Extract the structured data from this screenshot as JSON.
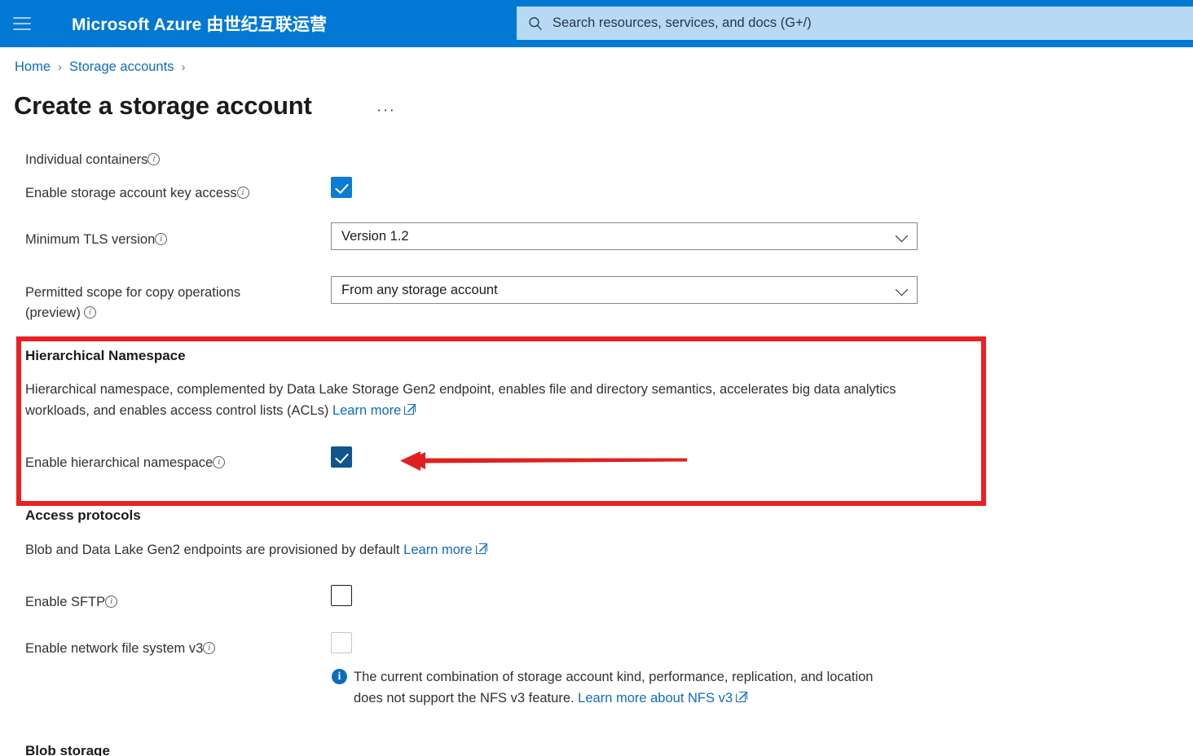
{
  "topbar": {
    "menu_icon": "hamburger-icon",
    "brand_prefix": "Microsoft Azure ",
    "brand_cn": "由世纪互联运营",
    "search": {
      "icon": "search-icon",
      "placeholder": "Search resources, services, and docs (G+/)",
      "value": ""
    }
  },
  "breadcrumb": {
    "items": [
      {
        "label": "Home"
      },
      {
        "label": "Storage accounts"
      }
    ],
    "separator": "›"
  },
  "page": {
    "title": "Create a storage account",
    "more_label": "···"
  },
  "form": {
    "truncated_top_label": "Individual containers",
    "key_access": {
      "label": "Enable storage account key access",
      "checked": true
    },
    "tls": {
      "label": "Minimum TLS version",
      "value": "Version 1.2"
    },
    "copy_scope": {
      "label_line1": "Permitted scope for copy operations",
      "label_line2": "(preview)",
      "value": "From any storage account"
    },
    "hierarchical_namespace": {
      "heading": "Hierarchical Namespace",
      "description_line1": "Hierarchical namespace, complemented by Data Lake Storage Gen2 endpoint, enables file and directory semantics, accelerates",
      "description_line2": "big data analytics workloads, and enables access control lists (ACLs)",
      "learn_more": "Learn more",
      "checkbox_label": "Enable hierarchical namespace",
      "checked": true,
      "highlight_color": "#ec2024",
      "annotation": "red-arrow pointing to enable hierarchical namespace checkbox"
    },
    "access_protocols": {
      "heading": "Access protocols",
      "description": "Blob and Data Lake Gen2 endpoints are provisioned by default",
      "learn_more": "Learn more",
      "sftp": {
        "label": "Enable SFTP",
        "checked": false
      },
      "nfs": {
        "label": "Enable network file system v3",
        "checked": false,
        "disabled": true
      },
      "notice_line1": "The current combination of storage account kind, performance, replication, and",
      "notice_line2": "location does not support the NFS v3 feature.",
      "notice_link": "Learn more about NFS v3"
    },
    "blob_storage_heading": "Blob storage"
  },
  "colors": {
    "azure_blue": "#0078d4",
    "link_blue": "#0f6cbd",
    "highlight_red": "#ec2024",
    "search_bg": "#b7d9f3"
  }
}
